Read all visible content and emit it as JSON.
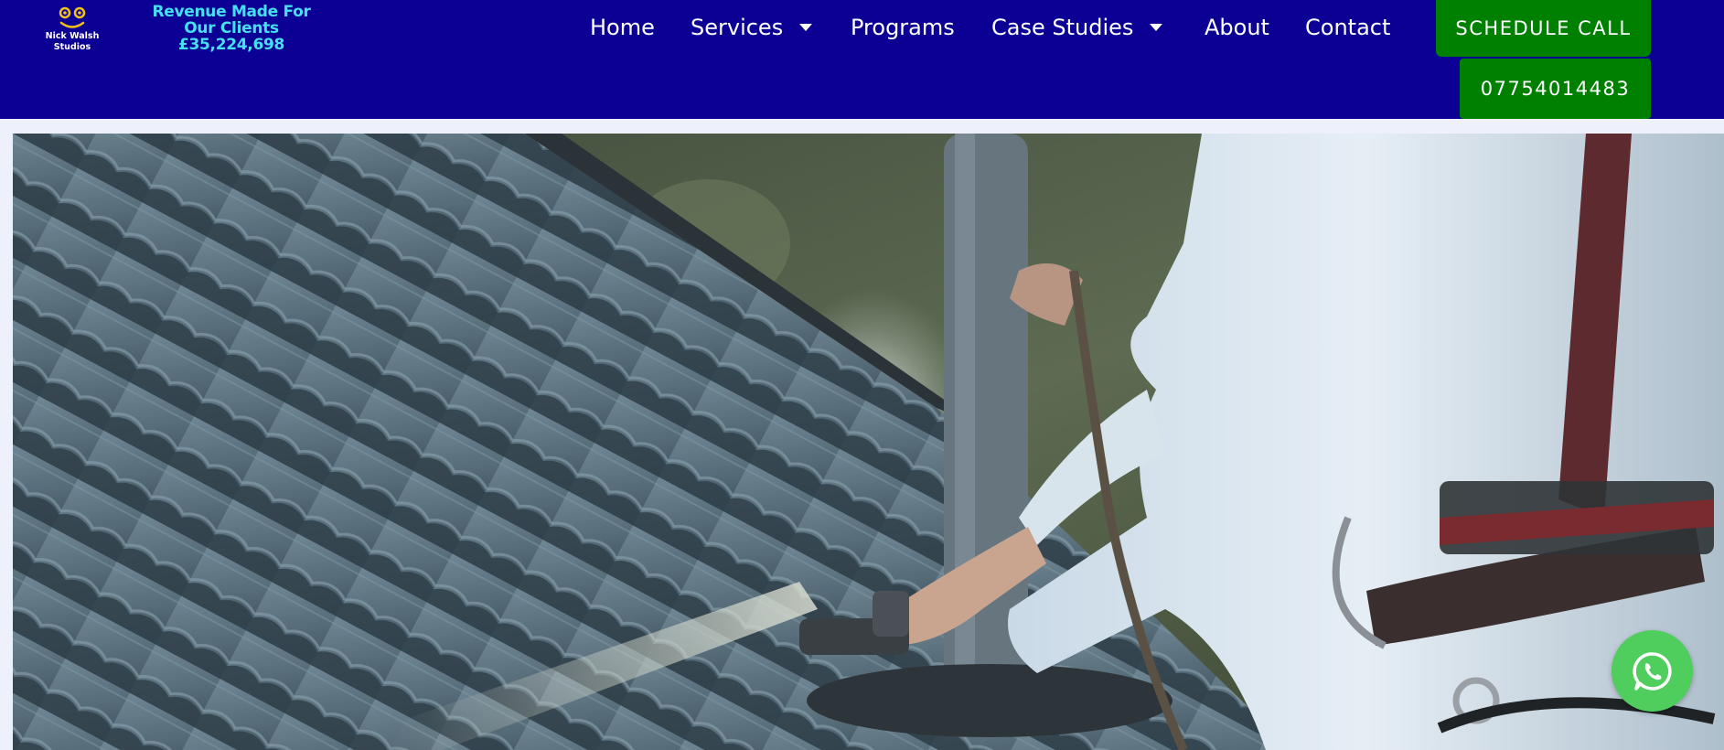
{
  "brand": {
    "logo_line1": "Nick Walsh",
    "logo_line2": "Studios",
    "tagline_line1": "Revenue Made For",
    "tagline_line2": "Our Clients",
    "tagline_line3": "£35,224,698"
  },
  "nav": {
    "items": [
      {
        "label": "Home",
        "has_dropdown": false
      },
      {
        "label": "Services",
        "has_dropdown": true
      },
      {
        "label": "Programs",
        "has_dropdown": false
      },
      {
        "label": "Case Studies",
        "has_dropdown": true
      },
      {
        "label": "About",
        "has_dropdown": false
      },
      {
        "label": "Contact",
        "has_dropdown": false
      }
    ]
  },
  "cta": {
    "schedule_label": "SCHEDULE CALL",
    "phone_label": "07754014483"
  },
  "hero": {
    "image_icon": "roof-spray-photo"
  },
  "chat": {
    "icon": "whatsapp-icon"
  },
  "colors": {
    "header_bg": "#0c0094",
    "accent_cyan": "#45e0f2",
    "cta_green": "#008000",
    "whatsapp_green": "#4fce5d",
    "page_bg": "#eef0fb"
  }
}
